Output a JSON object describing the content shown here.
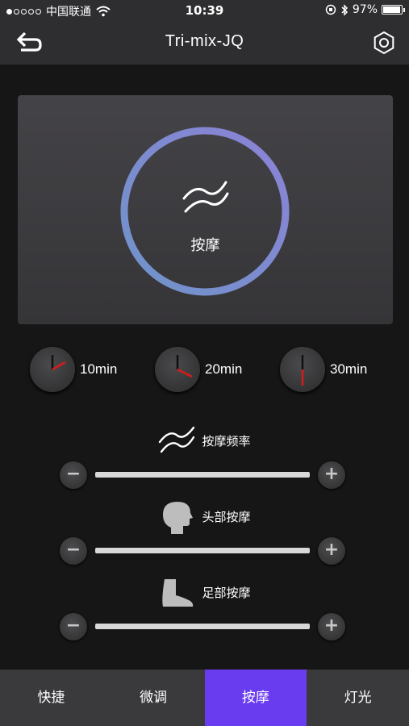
{
  "status_bar": {
    "carrier": "中国联通",
    "time": "10:39",
    "battery_text": "97%",
    "battery_level": 0.97,
    "signal_bars_filled": 1,
    "signal_bars_total": 5
  },
  "header": {
    "title": "Tri-mix-JQ",
    "back_icon": "back-arrow-icon",
    "settings_icon": "gear-icon"
  },
  "mode": {
    "label": "按摩",
    "icon": "massage-waves-icon"
  },
  "timers": [
    {
      "label": "10min",
      "icon": "clock-icon"
    },
    {
      "label": "20min",
      "icon": "clock-icon"
    },
    {
      "label": "30min",
      "icon": "clock-icon"
    }
  ],
  "controls": [
    {
      "label": "按摩频率",
      "icon": "massage-waves-icon"
    },
    {
      "label": "头部按摩",
      "icon": "head-icon"
    },
    {
      "label": "足部按摩",
      "icon": "foot-icon"
    }
  ],
  "tabs": [
    {
      "label": "快捷",
      "active": false
    },
    {
      "label": "微调",
      "active": false
    },
    {
      "label": "按摩",
      "active": true
    },
    {
      "label": "灯光",
      "active": false
    }
  ],
  "colors": {
    "accent": "#6a3cf0",
    "clock_hand": "#d81b1b",
    "ring_start": "#6f94c9",
    "ring_end": "#8b82d6"
  }
}
